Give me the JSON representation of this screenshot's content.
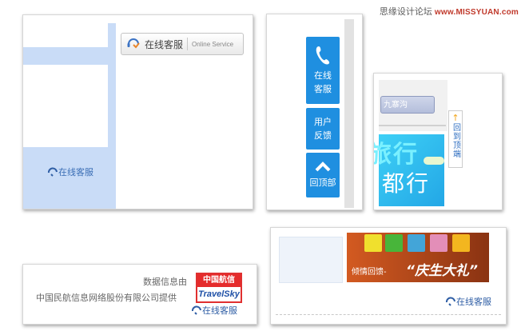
{
  "watermark": {
    "text": "思缘设计论坛",
    "brand": "www.MISSYUAN.com"
  },
  "panel_sidebar_btn": {
    "button_cn": "在线客服",
    "button_en": "Online Service",
    "link": "在线客服"
  },
  "panel_float_bar": {
    "buttons": [
      {
        "label": "在线客服",
        "icon": "phone-icon"
      },
      {
        "label": "用户反馈"
      },
      {
        "label": "回顶部",
        "icon": "chevron-up-icon"
      }
    ]
  },
  "panel_back_top": {
    "input_value": "九寨沟",
    "banner_text_1": "旅行",
    "banner_text_2": "都行",
    "back_top_label": "回到顶端"
  },
  "panel_footer": {
    "line1": "数据信息由",
    "line2": "中国民航信息网络股份有限公司提供",
    "logo_cn": "中国航信",
    "logo_en": "TravelSky",
    "link": "在线客服"
  },
  "panel_promo": {
    "banner_small": "倾情回馈-",
    "banner_big": "“庆生大礼”",
    "link": "在线客服"
  },
  "colors": {
    "accent_blue": "#1f8fe0",
    "link_blue": "#2f5ea5",
    "light_blue": "#c9dcf7"
  }
}
